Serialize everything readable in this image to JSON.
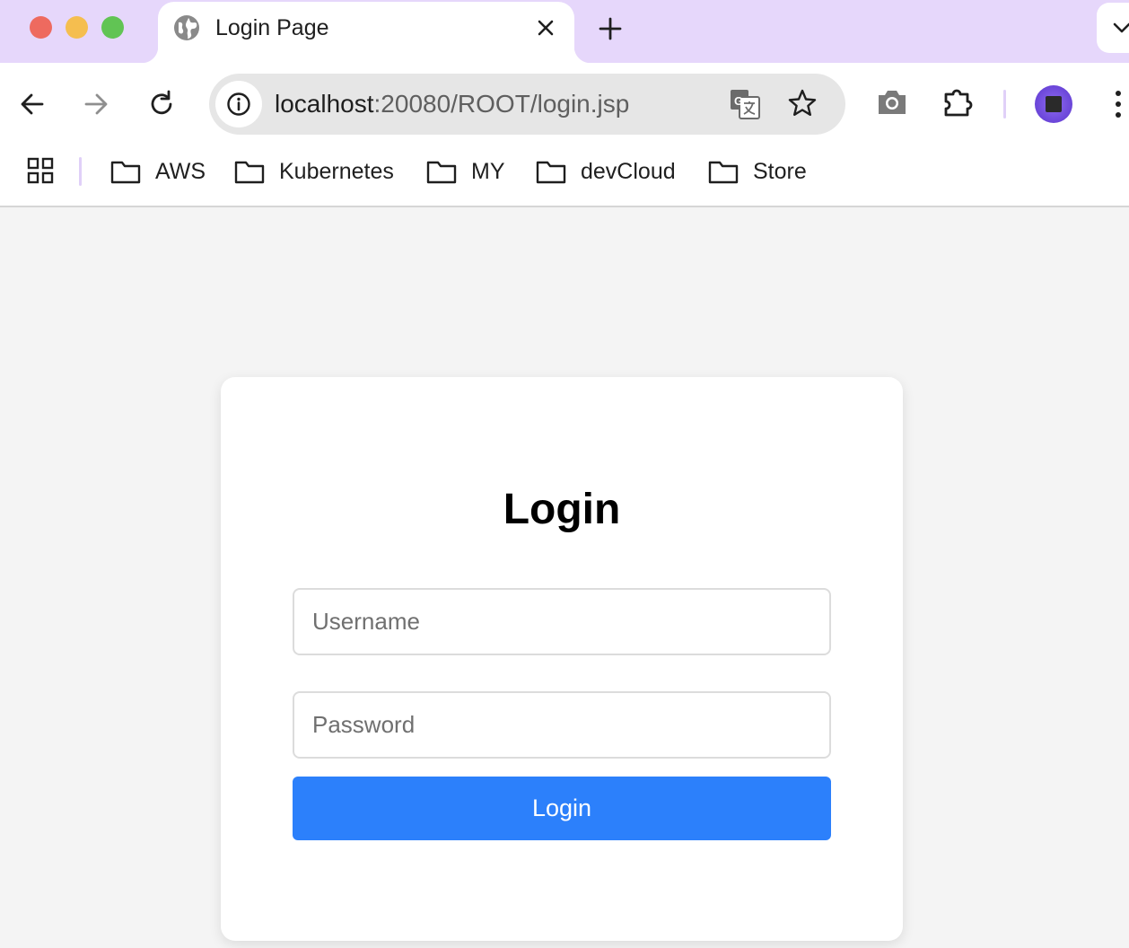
{
  "window": {
    "tab_title": "Login Page"
  },
  "toolbar": {
    "url_host": "localhost",
    "url_rest": ":20080/ROOT/login.jsp"
  },
  "bookmarks": [
    {
      "label": "AWS"
    },
    {
      "label": "Kubernetes"
    },
    {
      "label": "MY"
    },
    {
      "label": "devCloud"
    },
    {
      "label": "Store"
    }
  ],
  "login": {
    "title": "Login",
    "username_placeholder": "Username",
    "password_placeholder": "Password",
    "button_label": "Login"
  },
  "colors": {
    "tabstrip": "#e6d7fb",
    "accent_button": "#2c80fb",
    "page_background": "#f4f4f4"
  },
  "icons": [
    "globe-icon",
    "close-icon",
    "plus-icon",
    "chevron-down-icon",
    "back-arrow-icon",
    "forward-arrow-icon",
    "reload-icon",
    "info-icon",
    "translate-icon",
    "star-icon",
    "camera-icon",
    "extensions-icon",
    "avatar",
    "more-vert-icon",
    "apps-grid-icon",
    "folder-icon"
  ]
}
